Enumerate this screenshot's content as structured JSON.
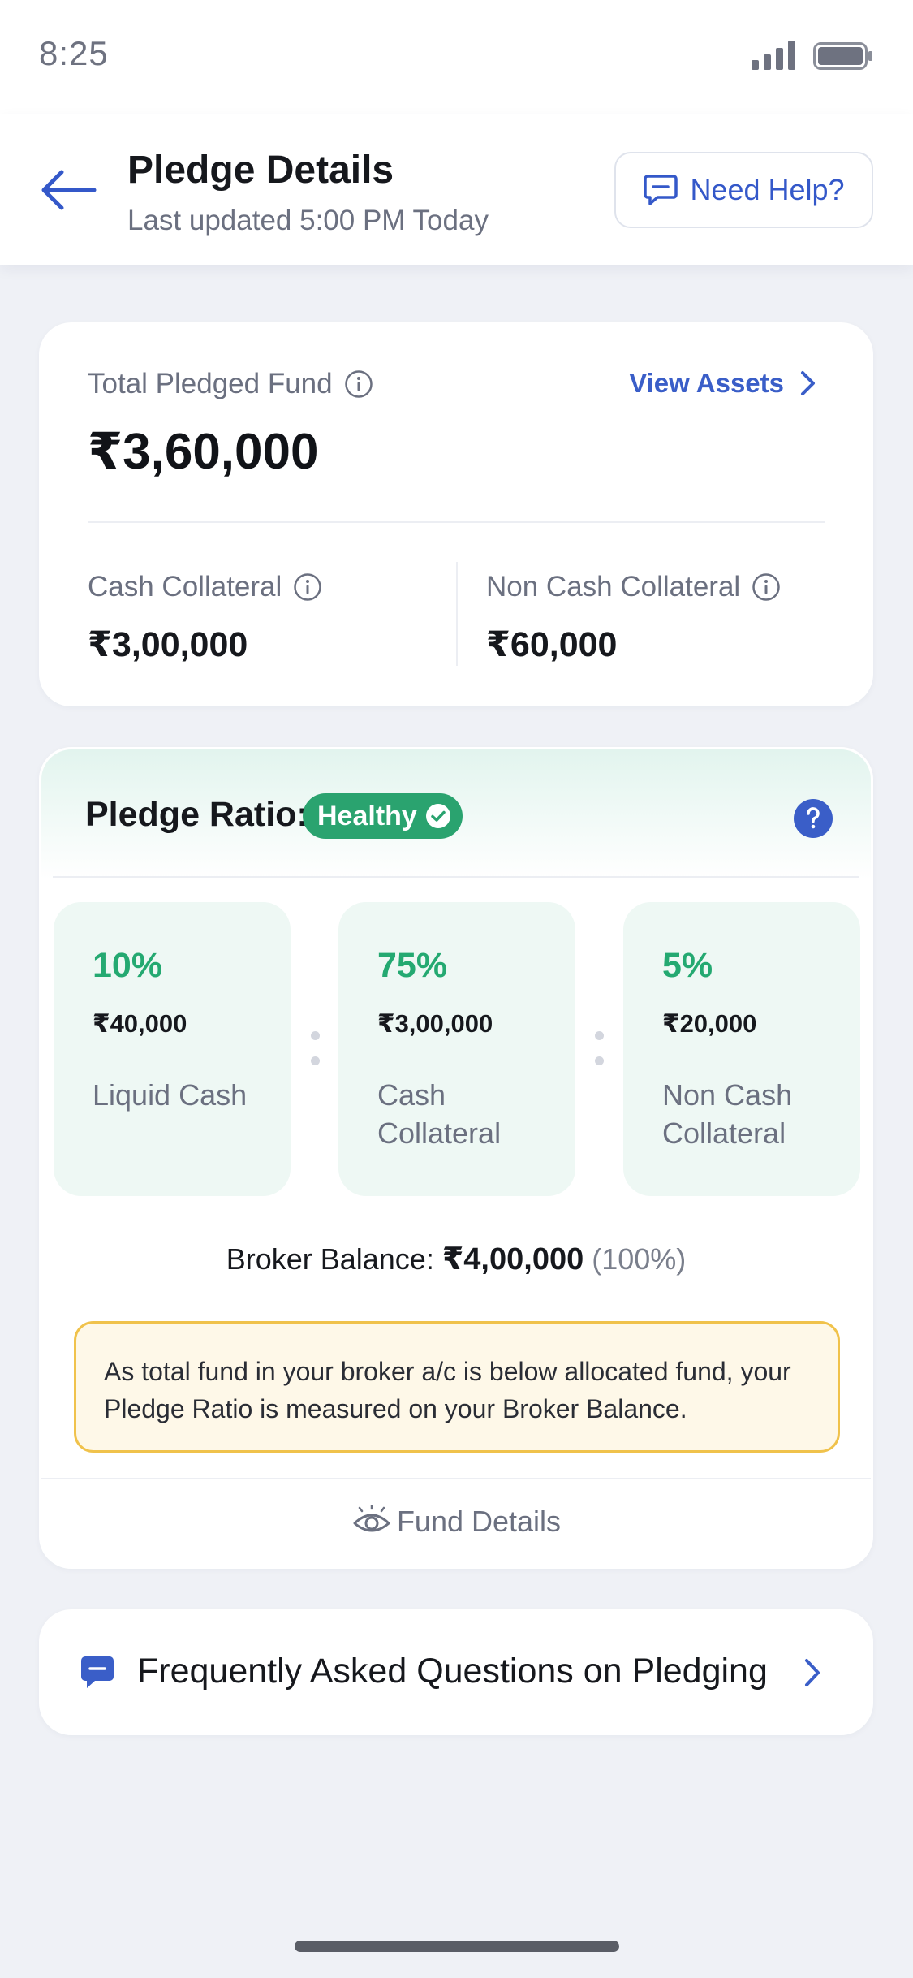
{
  "status_bar": {
    "time": "8:25"
  },
  "header": {
    "title": "Pledge Details",
    "subtitle": "Last updated 5:00 PM Today",
    "help_label": "Need Help?"
  },
  "total_card": {
    "label": "Total Pledged Fund",
    "amount": "₹3,60,000",
    "view_assets_label": "View Assets",
    "cash_label": "Cash Collateral",
    "cash_amount": "₹3,00,000",
    "noncash_label": "Non Cash Collateral",
    "noncash_amount": "₹60,000"
  },
  "ratio_card": {
    "title": "Pledge Ratio:",
    "status": "Healthy",
    "boxes": [
      {
        "percent": "10%",
        "amount": "₹40,000",
        "name": "Liquid Cash"
      },
      {
        "percent": "75%",
        "amount": "₹3,00,000",
        "name": "Cash Collateral"
      },
      {
        "percent": "5%",
        "amount": "₹20,000",
        "name": "Non Cash Collateral"
      }
    ],
    "broker_label": "Broker Balance:",
    "broker_amount": "₹4,00,000",
    "broker_percent": "(100%)",
    "warning": "As total fund in your broker a/c is below allocated fund, your Pledge Ratio is measured on your Broker Balance.",
    "fund_details_label": "Fund Details"
  },
  "faq": {
    "label": "Frequently Asked Questions on Pledging"
  },
  "colors": {
    "accent_blue": "#3458c9",
    "healthy_green": "#2aa36f",
    "ratio_box_bg": "#eef8f4",
    "warning_border": "#f0c24b",
    "warning_bg": "#fef8e8"
  },
  "icons": [
    "signal-icon",
    "battery-icon",
    "back-arrow-icon",
    "chat-icon",
    "info-icon",
    "chevron-right-icon",
    "check-circle-icon",
    "question-circle-icon",
    "eye-icon",
    "faq-chat-icon"
  ]
}
